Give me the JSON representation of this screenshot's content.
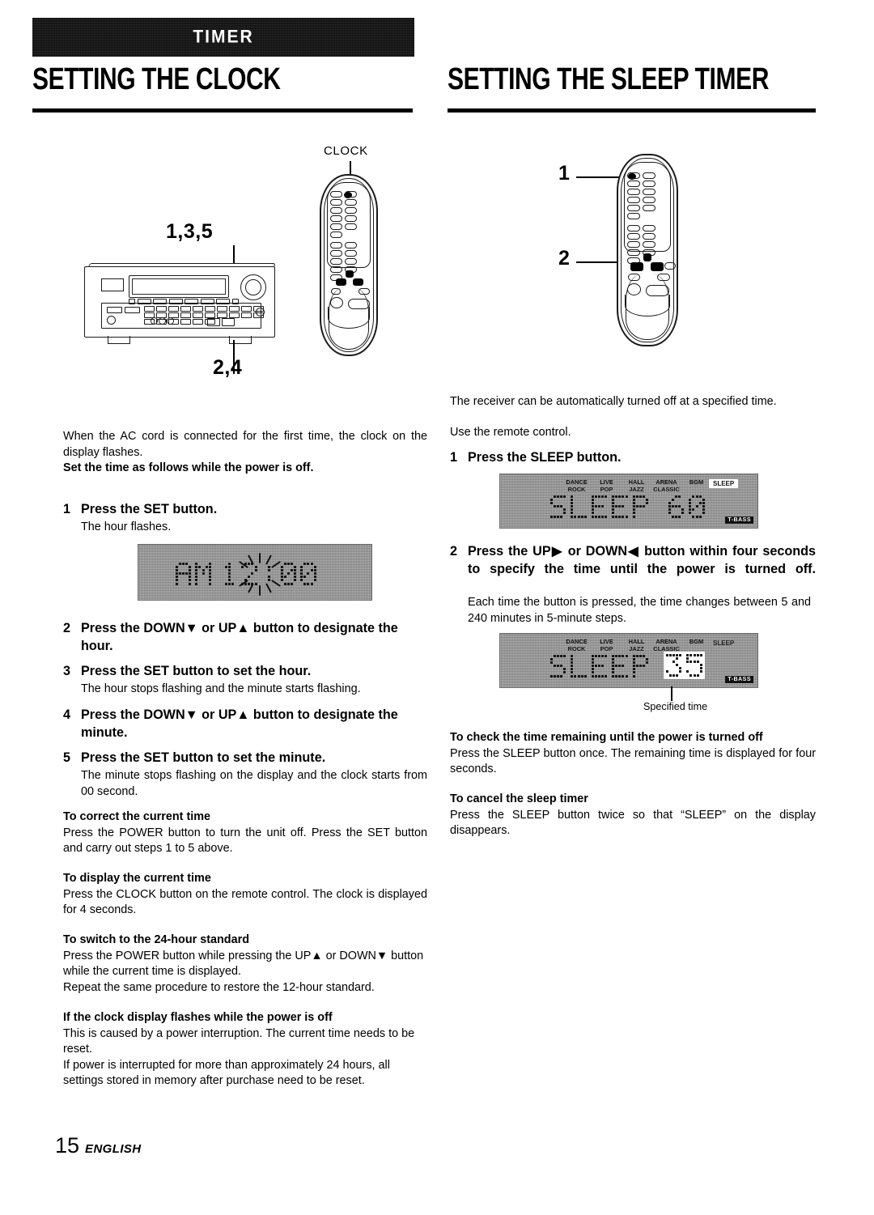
{
  "banner": {
    "title": "TIMER"
  },
  "footer": {
    "page": "15",
    "language": "ENGLISH"
  },
  "left": {
    "heading": "SETTING THE CLOCK",
    "callouts": {
      "set": "1,3,5",
      "updown": "2,4",
      "remote_button": "CLOCK"
    },
    "intro": "When the AC cord is connected for the first time, the clock on the display flashes.",
    "intro_bold": "Set the time as follows while the power is off.",
    "steps": [
      {
        "num": "1",
        "title": "Press the SET button.",
        "detail": "The hour flashes."
      },
      {
        "num": "2",
        "title": "Press the DOWN▼ or UP▲ button to designate the hour.",
        "detail": ""
      },
      {
        "num": "3",
        "title": "Press the SET button to set the hour.",
        "detail": "The hour stops flashing and the minute starts flashing."
      },
      {
        "num": "4",
        "title": "Press the DOWN▼ or UP▲ button to designate the minute.",
        "detail": ""
      },
      {
        "num": "5",
        "title": "Press the SET button to set the minute.",
        "detail": "The minute stops flashing on the display and the clock starts from 00 second."
      }
    ],
    "display": {
      "ampm": "AM",
      "hour": "12",
      "colon": ":",
      "minute": "00"
    },
    "subsections": [
      {
        "heading": "To correct the current time",
        "body": "Press the POWER button to turn the unit off. Press the SET button and carry out steps 1 to 5 above."
      },
      {
        "heading": "To display the current time",
        "body": "Press the CLOCK button on the remote control. The clock is displayed for 4 seconds."
      },
      {
        "heading": "To switch to the 24-hour standard",
        "body": "Press the POWER button while pressing the UP▲ or DOWN▼ button while the current time is displayed.",
        "body2": "Repeat the same procedure to restore the 12-hour standard."
      },
      {
        "heading": "If the clock display flashes while the power is off",
        "body": "This is caused by a power interruption. The current time needs to be reset.",
        "body2": "If power is interrupted for more than approximately 24 hours, all settings stored in memory after purchase need to be reset."
      }
    ]
  },
  "right": {
    "heading": "SETTING THE SLEEP TIMER",
    "callouts": {
      "one": "1",
      "two": "2"
    },
    "intro": "The receiver can be automatically turned off at a specified time.",
    "intro2": "Use the remote control.",
    "steps": [
      {
        "num": "1",
        "title": "Press the SLEEP button.",
        "detail": ""
      },
      {
        "num": "2",
        "title": "Press the UP▶ or DOWN◀ button within four seconds to specify the time until the power is turned off.",
        "detail": "Each time the button is pressed, the time changes between 5 and 240 minutes in 5-minute steps."
      }
    ],
    "display1": {
      "word": "SLEEP",
      "value": "60",
      "sleep_tag": "SLEEP",
      "tbass": "T-BASS"
    },
    "display2": {
      "word": "SLEEP",
      "value": "35",
      "sleep_tag": "SLEEP",
      "tbass": "T-BASS"
    },
    "display_caption": "Specified time",
    "dsp_modes": [
      {
        "top": "DANCE",
        "bottom": "ROCK"
      },
      {
        "top": "LIVE",
        "bottom": "POP"
      },
      {
        "top": "HALL",
        "bottom": "JAZZ"
      },
      {
        "top": "ARENA",
        "bottom": "CLASSIC"
      },
      {
        "top": "",
        "bottom": "BGM"
      }
    ],
    "subsections": [
      {
        "heading": "To check the time remaining until the power is turned off",
        "body": "Press the SLEEP button once. The remaining time is displayed for four seconds."
      },
      {
        "heading": "To cancel the sleep timer",
        "body": "Press the SLEEP button twice so that “SLEEP” on the display disappears."
      }
    ]
  }
}
